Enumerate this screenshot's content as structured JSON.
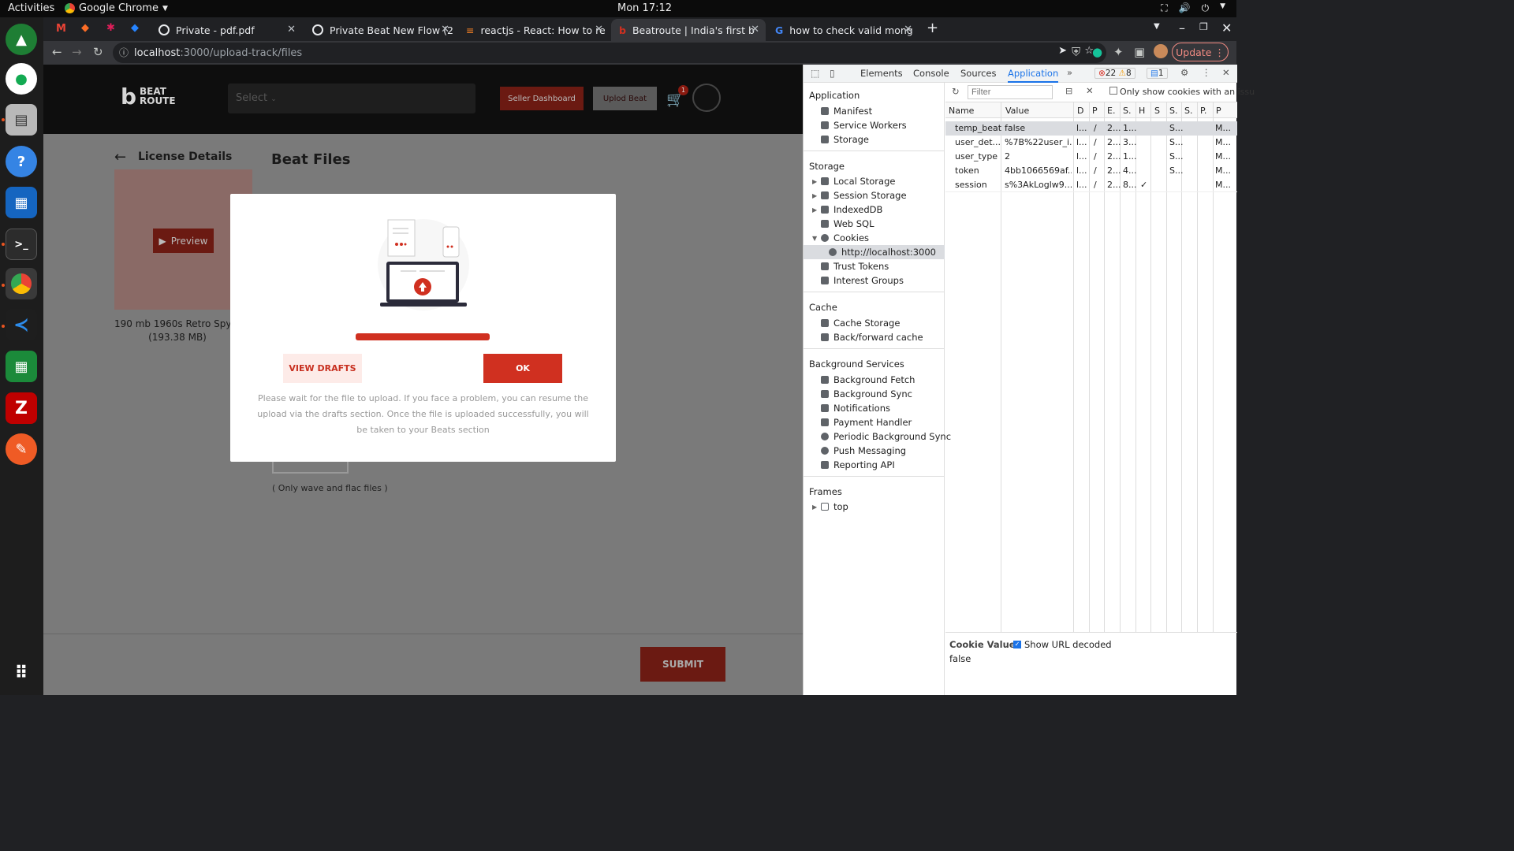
{
  "topbar": {
    "activities": "Activities",
    "app_name": "Google Chrome",
    "clock": "Mon 17:12"
  },
  "tabs": [
    {
      "label": "Private - pdf.pdf"
    },
    {
      "label": "Private Beat New Flow (2"
    },
    {
      "label": "reactjs - React: How to re"
    },
    {
      "label": "Beatroute | India's first b"
    },
    {
      "label": "how to check valid mong"
    }
  ],
  "toolbar": {
    "url_host": "localhost",
    "url_path": ":3000/upload-track/files",
    "update_label": "Update"
  },
  "site": {
    "logo_line1": "BEAT",
    "logo_line2": "ROUTE",
    "select_placeholder": "Select",
    "seller_dashboard": "Seller Dashboard",
    "upload_beat": "Uplod Beat",
    "cart_count": "1",
    "license_details": "License Details",
    "preview": "Preview",
    "track_name": "190 mb 1960s Retro Spy (1",
    "track_size": "(193.38 MB)",
    "beat_files": "Beat Files",
    "only_wave": "( Only wave and flac files )",
    "submit": "SUBMIT"
  },
  "modal": {
    "view_drafts": "VIEW DRAFTS",
    "ok": "OK",
    "message": "Please wait for the file to upload. If you face a problem, you can resume the upload via the drafts section. Once the file is uploaded successfully, you will be taken to your Beats section",
    "progress": 1.0
  },
  "devtools": {
    "tabs": [
      "Elements",
      "Console",
      "Sources",
      "Application"
    ],
    "errors": "22",
    "warnings": "8",
    "messages": "1",
    "sidebar": {
      "application_title": "Application",
      "application_items": [
        "Manifest",
        "Service Workers",
        "Storage"
      ],
      "storage_title": "Storage",
      "storage_items": [
        "Local Storage",
        "Session Storage",
        "IndexedDB",
        "Web SQL",
        "Cookies"
      ],
      "cookie_origin": "http://localhost:3000",
      "storage_items2": [
        "Trust Tokens",
        "Interest Groups"
      ],
      "cache_title": "Cache",
      "cache_items": [
        "Cache Storage",
        "Back/forward cache"
      ],
      "bg_title": "Background Services",
      "bg_items": [
        "Background Fetch",
        "Background Sync",
        "Notifications",
        "Payment Handler",
        "Periodic Background Sync",
        "Push Messaging",
        "Reporting API"
      ],
      "frames_title": "Frames",
      "frames_items": [
        "top"
      ]
    },
    "filter_placeholder": "Filter",
    "only_show": "Only show cookies with an issu",
    "columns": [
      "Name",
      "Value",
      "D",
      "P",
      "E.",
      "S.",
      "H",
      "S",
      "S.",
      "S.",
      "P.",
      "P"
    ],
    "rows": [
      {
        "name": "temp_beat",
        "value": "false",
        "d": "l...",
        "p": "/",
        "e": "2...",
        "s": "1...",
        "h": "",
        "ss": "S...",
        "last": "M..."
      },
      {
        "name": "user_det...",
        "value": "%7B%22user_i...",
        "d": "l...",
        "p": "/",
        "e": "2...",
        "s": "3...",
        "h": "",
        "ss": "S...",
        "last": "M..."
      },
      {
        "name": "user_type",
        "value": "2",
        "d": "l...",
        "p": "/",
        "e": "2...",
        "s": "1...",
        "h": "",
        "ss": "S...",
        "last": "M..."
      },
      {
        "name": "token",
        "value": "4bb1066569af...",
        "d": "l...",
        "p": "/",
        "e": "2...",
        "s": "4...",
        "h": "",
        "ss": "S...",
        "last": "M..."
      },
      {
        "name": "session",
        "value": "s%3AkLoglw9...",
        "d": "l...",
        "p": "/",
        "e": "2...",
        "s": "8...",
        "h": "✓",
        "ss": "",
        "last": "M..."
      }
    ],
    "cookie_value_label": "Cookie Value",
    "show_url_decoded": "Show URL decoded",
    "cookie_value": "false"
  }
}
